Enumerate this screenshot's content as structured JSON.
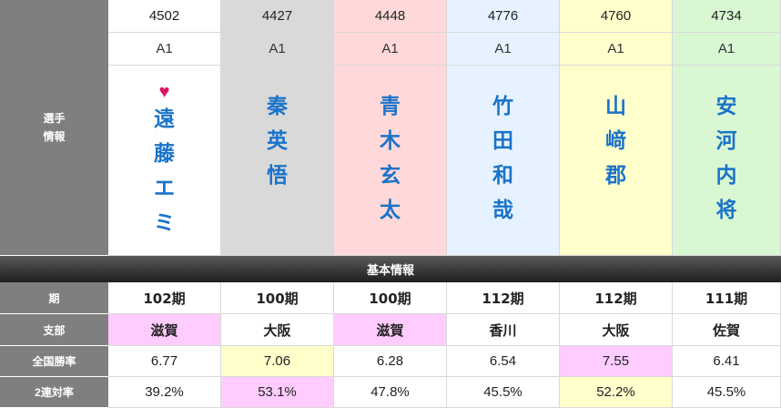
{
  "header_label": "選手\n情報",
  "section_title": "基本情報",
  "colors": {
    "col_bg": [
      "#ffffff",
      "#d9d9d9",
      "#ffd9d9",
      "#e6f2ff",
      "#ffffcc",
      "#d9f7d3"
    ],
    "highlight_pink": "#ffccff",
    "highlight_yellow": "#ffffcc",
    "name_blue": "#1a73c9",
    "label_gray": "#7f7f7f"
  },
  "racers": [
    {
      "id": "4502",
      "class": "A1",
      "name": [
        "遠",
        "藤",
        "エ",
        "ミ"
      ],
      "favorite": true
    },
    {
      "id": "4427",
      "class": "A1",
      "name": [
        "秦",
        "英",
        "悟"
      ],
      "favorite": false
    },
    {
      "id": "4448",
      "class": "A1",
      "name": [
        "青",
        "木",
        "玄",
        "太"
      ],
      "favorite": false
    },
    {
      "id": "4776",
      "class": "A1",
      "name": [
        "竹",
        "田",
        "和",
        "哉"
      ],
      "favorite": false
    },
    {
      "id": "4760",
      "class": "A1",
      "name": [
        "山",
        "﨑",
        "郡"
      ],
      "favorite": false
    },
    {
      "id": "4734",
      "class": "A1",
      "name": [
        "安",
        "河",
        "内",
        "将"
      ],
      "favorite": false
    }
  ],
  "rows": [
    {
      "label": "期",
      "values": [
        "102期",
        "100期",
        "100期",
        "112期",
        "112期",
        "111期"
      ],
      "highlight": [
        "",
        "",
        "",
        "",
        "",
        ""
      ],
      "bold": true
    },
    {
      "label": "支部",
      "values": [
        "滋賀",
        "大阪",
        "滋賀",
        "香川",
        "大阪",
        "佐賀"
      ],
      "highlight": [
        "pink",
        "",
        "pink",
        "",
        "",
        ""
      ],
      "bold": true
    },
    {
      "label": "全国勝率",
      "values": [
        "6.77",
        "7.06",
        "6.28",
        "6.54",
        "7.55",
        "6.41"
      ],
      "highlight": [
        "",
        "yellow",
        "",
        "",
        "pink",
        ""
      ],
      "bold": false
    },
    {
      "label": "2連対率",
      "values": [
        "39.2%",
        "53.1%",
        "47.8%",
        "45.5%",
        "52.2%",
        "45.5%"
      ],
      "highlight": [
        "",
        "pink",
        "",
        "",
        "yellow",
        ""
      ],
      "bold": false
    }
  ],
  "heart_icon": "♥"
}
